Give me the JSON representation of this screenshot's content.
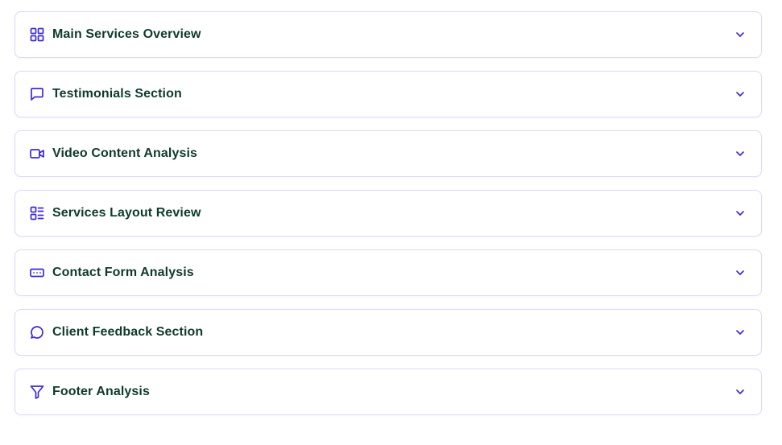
{
  "accordion": {
    "items": [
      {
        "label": "Main Services Overview",
        "icon": "grid-icon"
      },
      {
        "label": "Testimonials Section",
        "icon": "message-square-icon"
      },
      {
        "label": "Video Content Analysis",
        "icon": "video-camera-icon"
      },
      {
        "label": "Services Layout Review",
        "icon": "list-layout-icon"
      },
      {
        "label": "Contact Form Analysis",
        "icon": "form-input-icon"
      },
      {
        "label": "Client Feedback Section",
        "icon": "message-circle-icon"
      },
      {
        "label": "Footer Analysis",
        "icon": "filter-icon"
      }
    ],
    "expand_icon": "chevron-down-icon"
  },
  "colors": {
    "accent": "#3b2bd6",
    "label_text": "#0f3b2b",
    "card_border": "#dcd8f6",
    "background": "#ffffff"
  }
}
